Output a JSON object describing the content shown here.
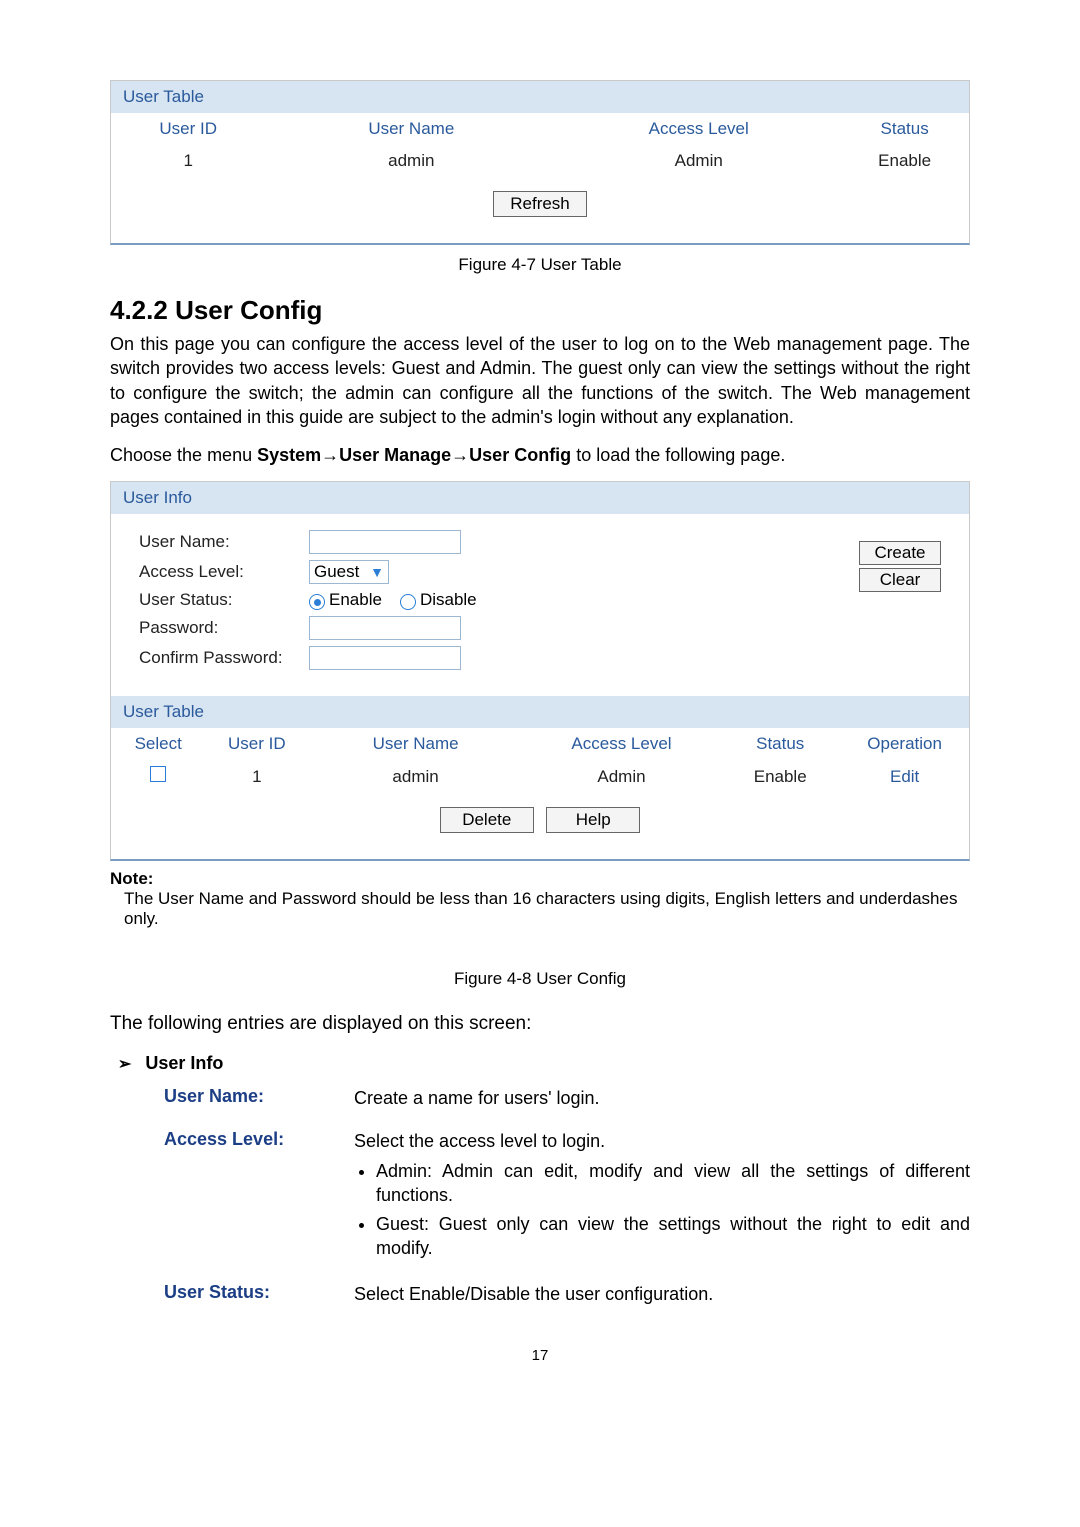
{
  "userTable1": {
    "title": "User Table",
    "headers": {
      "userId": "User ID",
      "userName": "User Name",
      "accessLevel": "Access Level",
      "status": "Status"
    },
    "rows": [
      {
        "userId": "1",
        "userName": "admin",
        "accessLevel": "Admin",
        "status": "Enable"
      }
    ],
    "refresh": "Refresh"
  },
  "fig7": "Figure 4-7 User Table",
  "section": {
    "number": "4.2.2",
    "title": "User Config"
  },
  "para1": "On this page you can configure the access level of the user to log on to the Web management page. The switch provides two access levels: Guest and Admin. The guest only can view the settings without the right to configure the switch; the admin can configure all the functions of the switch. The Web management pages contained in this guide are subject to the admin's login without any explanation.",
  "menuLine": {
    "pre": "Choose the menu ",
    "path": "System→User Manage→User Config",
    "post": " to load the following page."
  },
  "userInfo": {
    "title": "User Info",
    "labels": {
      "userName": "User Name:",
      "accessLevel": "Access Level:",
      "userStatus": "User Status:",
      "password": "Password:",
      "confirm": "Confirm Password:"
    },
    "accessSelect": "Guest",
    "status": {
      "enable": "Enable",
      "disable": "Disable"
    },
    "buttons": {
      "create": "Create",
      "clear": "Clear"
    }
  },
  "userTable2": {
    "title": "User Table",
    "headers": {
      "select": "Select",
      "userId": "User ID",
      "userName": "User Name",
      "accessLevel": "Access Level",
      "status": "Status",
      "operation": "Operation"
    },
    "rows": [
      {
        "userId": "1",
        "userName": "admin",
        "accessLevel": "Admin",
        "status": "Enable",
        "operation": "Edit"
      }
    ],
    "buttons": {
      "delete": "Delete",
      "help": "Help"
    }
  },
  "note": {
    "title": "Note:",
    "text": "The User Name and Password should be less than 16 characters using digits, English letters and underdashes only."
  },
  "fig8": "Figure 4-8 User Config",
  "entriesIntro": "The following entries are displayed on this screen:",
  "descSection": "User Info",
  "desc": {
    "userName": {
      "term": "User Name:",
      "def": "Create a name for users' login."
    },
    "accessLevel": {
      "term": "Access Level:",
      "def": "Select the access level to login.",
      "b1": "Admin: Admin can edit, modify and view all the settings of different functions.",
      "b2": "Guest: Guest only can view the settings without the right to edit and modify."
    },
    "userStatus": {
      "term": "User Status:",
      "def": "Select Enable/Disable the user configuration."
    }
  },
  "pageNumber": "17"
}
